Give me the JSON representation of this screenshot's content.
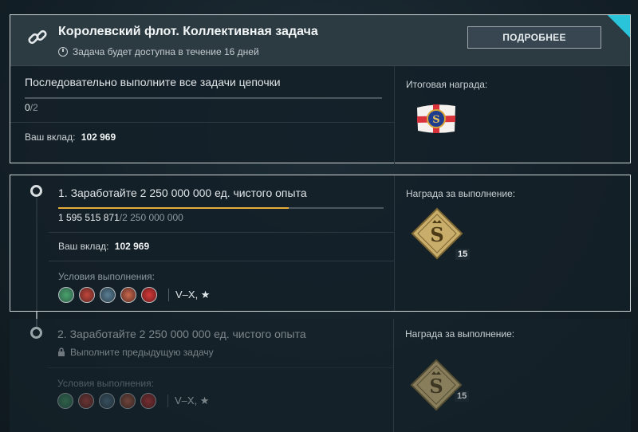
{
  "header": {
    "title": "Королевский флот. Коллективная задача",
    "availability": "Задача будет доступна в течение 16 дней",
    "details_button": "ПОДРОБНЕЕ",
    "icon": "link-icon"
  },
  "chain": {
    "description": "Последовательно выполните все задачи цепочки",
    "progress_done": "0",
    "progress_total": "/2",
    "progress_fraction": 0.0,
    "contribution_label": "Ваш вклад:",
    "contribution_value": "102 969",
    "reward_label": "Итоговая награда:",
    "reward_icon": "royal-navy-flag"
  },
  "tasks": [
    {
      "title": "1. Заработайте 2 250 000 000 ед. чистого опыта",
      "progress_current": "1 595 515 871",
      "progress_total": "/2 250 000 000",
      "progress_fraction": 0.709,
      "contribution_label": "Ваш вклад:",
      "contribution_value": "102 969",
      "conditions_label": "Условия выполнения:",
      "tiers": "V–X, ★",
      "reward_label": "Награда за выполнение:",
      "reward_count": "15",
      "reward_icon": "sovereign-token-icon",
      "state": "active"
    },
    {
      "title": "2. Заработайте 2 250 000 000 ед. чистого опыта",
      "locked_text": "Выполните предыдущую задачу",
      "conditions_label": "Условия выполнения:",
      "tiers": "V–X, ★",
      "reward_label": "Награда за выполнение:",
      "reward_count": "15",
      "reward_icon": "sovereign-token-icon",
      "state": "locked"
    }
  ],
  "colors": {
    "accent_progress": "#e7ad3b",
    "corner_accent": "#29c4d9"
  }
}
